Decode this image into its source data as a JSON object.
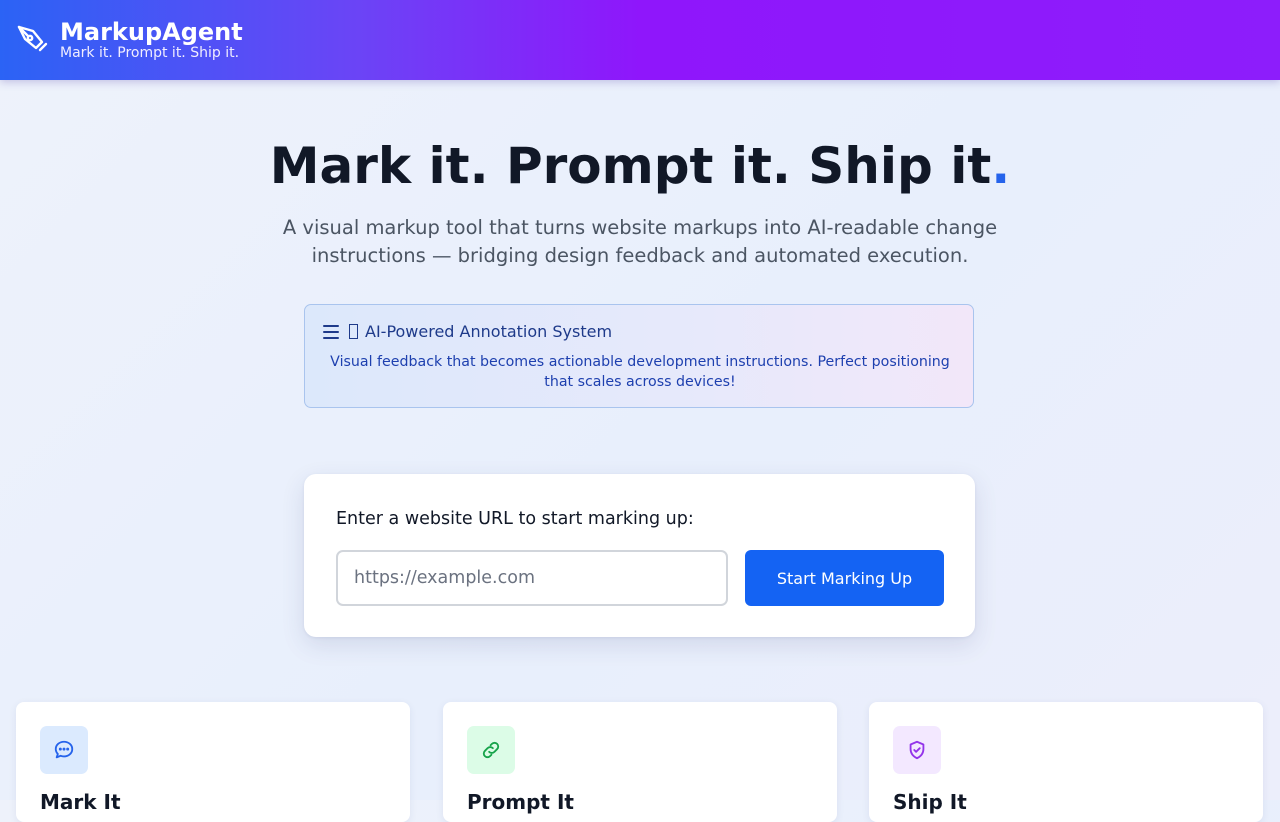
{
  "header": {
    "brand_name": "MarkupAgent",
    "tagline": "Mark it. Prompt it. Ship it.",
    "logo_icon": "pen-nib-icon"
  },
  "hero": {
    "title_main": "Mark it. Prompt it. Ship it",
    "title_dot": ".",
    "subtitle": "A visual markup tool that turns website markups into AI-readable change instructions — bridging design feedback and automated execution."
  },
  "feature": {
    "icon": "menu-icon",
    "title": "AI-Powered Annotation System",
    "description": "Visual feedback that becomes actionable development instructions. Perfect positioning that scales across devices!"
  },
  "url_form": {
    "label": "Enter a website URL to start marking up:",
    "input_value": "",
    "placeholder": "https://example.com",
    "button_label": "Start Marking Up"
  },
  "steps": [
    {
      "title": "Mark It",
      "icon": "chat-bubble-icon",
      "color": "#2563eb"
    },
    {
      "title": "Prompt It",
      "icon": "link-icon",
      "color": "#16a34a"
    },
    {
      "title": "Ship It",
      "icon": "shield-check-icon",
      "color": "#9333ea"
    }
  ],
  "colors": {
    "accent": "#2563eb",
    "button": "#1463f3",
    "header_start": "#2b63f5",
    "header_end": "#8d1dfb"
  }
}
